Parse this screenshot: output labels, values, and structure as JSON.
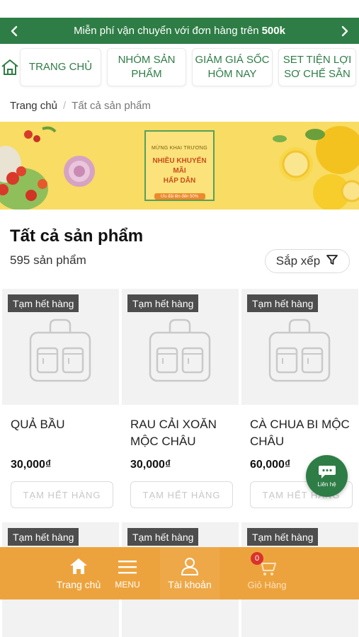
{
  "promo": {
    "text": "Miễn phí vận chuyển với đơn hàng trên",
    "highlight": "500k"
  },
  "nav": {
    "home_icon": "home-icon",
    "tabs": [
      {
        "label_1": "TRANG CHỦ",
        "label_2": ""
      },
      {
        "label_1": "NHÓM SẢN",
        "label_2": "PHẨM"
      },
      {
        "label_1": "GIẢM GIÁ SỐC",
        "label_2": "HÔM NAY"
      },
      {
        "label_1": "SET TIỆN LỢI",
        "label_2": "SƠ CHẾ SẴN"
      }
    ]
  },
  "breadcrumb": {
    "home": "Trang chủ",
    "separator": "/",
    "current": "Tất cả sản phẩm"
  },
  "banner": {
    "line1": "MỪNG KHAI TRƯƠNG",
    "line2": "NHIỀU KHUYẾN MÃI",
    "line3": "HẤP DẪN",
    "button": "Ưu đãi lên đến 50%"
  },
  "listing": {
    "title": "Tất cả sản phẩm",
    "count": "595 sản phẩm",
    "sort_label": "Sắp xếp"
  },
  "products": [
    {
      "badge": "Tạm hết hàng",
      "name": "QUẢ BẦU",
      "price": "30,000₫",
      "button": "TẠM HẾT HÀNG"
    },
    {
      "badge": "Tạm hết hàng",
      "name": "RAU CẢI XOĂN MỘC CHÂU",
      "price": "30,000₫",
      "button": "TẠM HẾT HÀNG"
    },
    {
      "badge": "Tạm hết hàng",
      "name": "CÀ CHUA BI MỘC CHÂU",
      "price": "60,000₫",
      "button": "TẠM HẾT HÀNG"
    },
    {
      "badge": "Tạm hết hàng"
    },
    {
      "badge": "Tạm hết hàng"
    },
    {
      "badge": "Tạm hết hàng"
    }
  ],
  "contact": {
    "label": "Liên hệ"
  },
  "bottom_nav": {
    "home": "Trang chủ",
    "menu": "MENU",
    "account": "Tài khoản",
    "cart": "Giỏ Hàng",
    "cart_count": "0"
  },
  "colors": {
    "primary_green": "#2e7d46",
    "bottom_orange": "#eda33d",
    "banner_yellow": "#f8dc64"
  }
}
